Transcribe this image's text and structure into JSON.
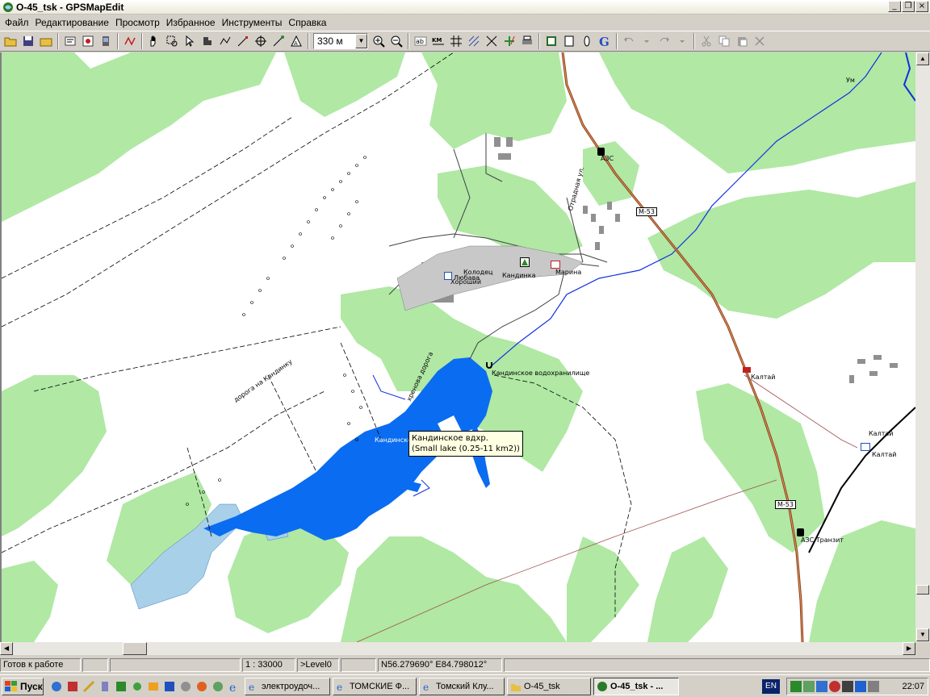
{
  "window": {
    "title": "O-45_tsk - GPSMapEdit"
  },
  "menu": [
    "Файл",
    "Редактирование",
    "Просмотр",
    "Избранное",
    "Инструменты",
    "Справка"
  ],
  "toolbar": {
    "scale_value": "330 м",
    "icons": [
      "open-icon",
      "save-icon",
      "folder-icon",
      "properties-icon",
      "waypoint-icon",
      "gps-icon",
      "hand-icon",
      "zoom-rect-icon",
      "pointer-icon",
      "pan-icon",
      "polyline-icon",
      "node-icon",
      "move-icon",
      "transform-icon",
      "label-icon",
      "zoom-in-icon",
      "zoom-out-icon",
      "labels-ab-icon",
      "scale-km-icon",
      "grid-icon",
      "hatch-icon",
      "route-icon",
      "plus-icon",
      "print-icon",
      "layers-icon",
      "page-icon",
      "info-icon",
      "google-icon",
      "undo-icon",
      "redo-icon",
      "cut-icon",
      "copy-icon",
      "paste-icon",
      "delete-icon"
    ]
  },
  "map": {
    "labels": {
      "um": "Ум",
      "azs": "АЗС",
      "m53_1": "М-53",
      "m53_2": "М-53",
      "otradnaya": "Отрадная ул.",
      "kolodec": "Колодец",
      "lyubava": "Любава",
      "horoshiy": "Хороший",
      "kandinka": "Кандинка",
      "marina": "Марина",
      "road_kandinka": "дорога на Кандинку",
      "kandinskoe_reservoir": "Кандинское водохранилище",
      "kandinsko": "Кандинско",
      "hrenova": "хренова дорога",
      "kaltay_1": "Калтай",
      "kaltay_2": "Калтай",
      "kaltay_3": "Калтай",
      "azs_tranzit": "АЗС Транзит"
    },
    "tooltip": {
      "line1": "Кандинское вдхр.",
      "line2": "(Small lake (0.25-11 km2))"
    },
    "colors": {
      "forest": "#b0e8a4",
      "water": "#0a6cf0",
      "road": "#8a3c1a",
      "river": "#1030e0",
      "marsh": "#a8d0e8"
    }
  },
  "status": {
    "ready": "Готов к работе",
    "scale": "1 : 33000",
    "level": ">Level0",
    "coords": "N56.279690° E84.798012°"
  },
  "taskbar": {
    "start": "Пуск",
    "tasks": [
      "электроудоч...",
      "ТОМСКИЕ Ф...",
      "Томский Клу...",
      "O-45_tsk",
      "O-45_tsk - ..."
    ],
    "lang": "EN",
    "clock": "22:07"
  }
}
